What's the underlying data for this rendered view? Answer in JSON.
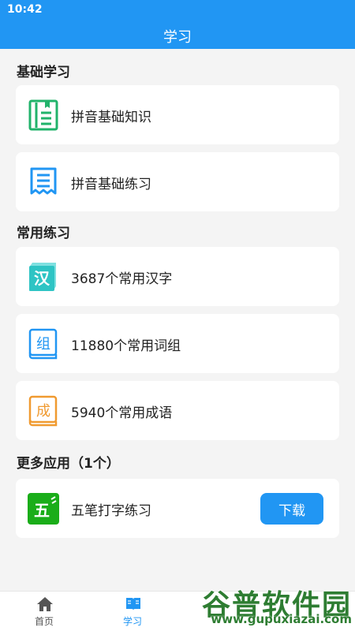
{
  "status_bar": {
    "time": "10:42"
  },
  "header": {
    "title": "学习"
  },
  "sections": {
    "basic": {
      "title": "基础学习"
    },
    "common": {
      "title": "常用练习"
    },
    "more": {
      "title": "更多应用（1个）"
    }
  },
  "cards": {
    "pinyin_knowledge": {
      "label": "拼音基础知识",
      "icon": "document-icon"
    },
    "pinyin_practice": {
      "label": "拼音基础练习",
      "icon": "receipt-icon"
    },
    "common_chars": {
      "label": "3687个常用汉字",
      "icon_char": "汉"
    },
    "common_words": {
      "label": "11880个常用词组",
      "icon_char": "组"
    },
    "common_idioms": {
      "label": "5940个常用成语",
      "icon_char": "成"
    },
    "wubi": {
      "label": "五笔打字练习",
      "icon_char": "五",
      "button": "下载"
    }
  },
  "bottom_nav": {
    "items": [
      {
        "label": "首页",
        "icon": "home-icon",
        "active": false
      },
      {
        "label": "学习",
        "icon": "book-icon",
        "active": true
      }
    ]
  },
  "watermark": {
    "text": "谷普软件园",
    "url": "www.gupuxiazai.com"
  },
  "colors": {
    "primary": "#2196f3",
    "green": "#21b36b",
    "teal": "#2ec4c4",
    "orange": "#f09a30",
    "wubi_green": "#1aad19"
  }
}
